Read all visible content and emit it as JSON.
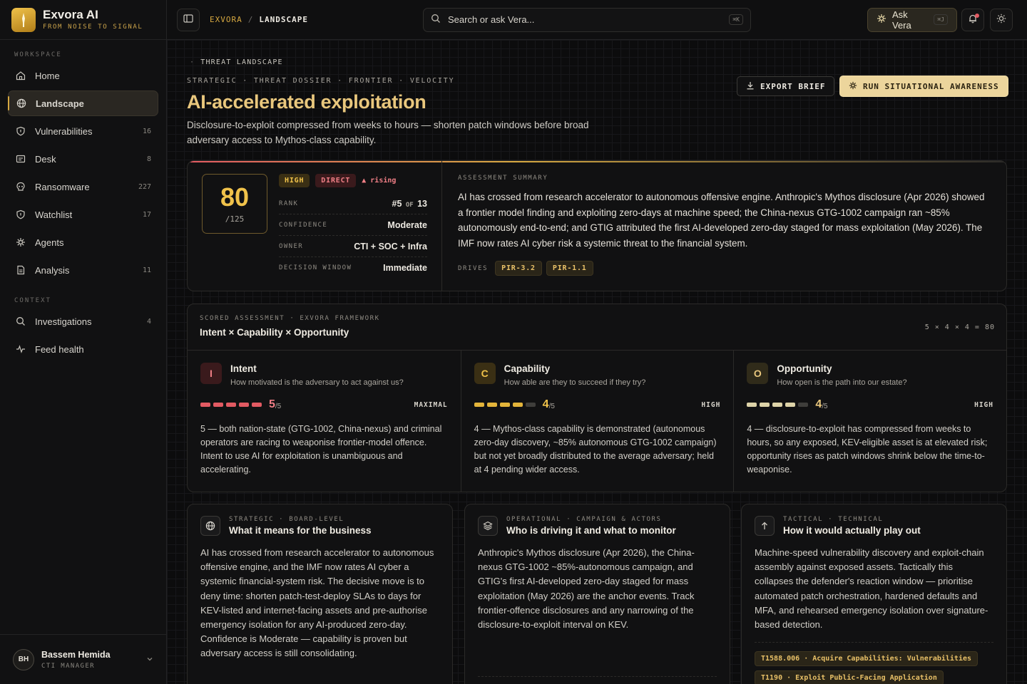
{
  "brand": {
    "name": "Exvora AI",
    "tagline": "FROM NOISE TO SIGNAL"
  },
  "sidebar": {
    "workspace_label": "WORKSPACE",
    "context_label": "CONTEXT",
    "workspace": [
      {
        "label": "Home",
        "icon": "home-icon",
        "count": ""
      },
      {
        "label": "Landscape",
        "icon": "globe-icon",
        "count": "",
        "active": true
      },
      {
        "label": "Vulnerabilities",
        "icon": "shield-icon",
        "count": "16"
      },
      {
        "label": "Desk",
        "icon": "desk-icon",
        "count": "8"
      },
      {
        "label": "Ransomware",
        "icon": "skull-icon",
        "count": "227"
      },
      {
        "label": "Watchlist",
        "icon": "shield-icon",
        "count": "17"
      },
      {
        "label": "Agents",
        "icon": "sparkle-icon",
        "count": ""
      },
      {
        "label": "Analysis",
        "icon": "document-icon",
        "count": "11"
      }
    ],
    "context": [
      {
        "label": "Investigations",
        "icon": "search-icon",
        "count": "4"
      },
      {
        "label": "Feed health",
        "icon": "pulse-icon",
        "count": ""
      }
    ],
    "user": {
      "initials": "BH",
      "name": "Bassem Hemida",
      "role": "CTI MANAGER"
    }
  },
  "topbar": {
    "crumb_root": "EXVORA",
    "crumb_sep": "/",
    "crumb_page": "LANDSCAPE",
    "search_placeholder": "Search or ask Vera...",
    "search_kbd": "⌘K",
    "ask_label": "Ask Vera",
    "ask_kbd": "⌘J"
  },
  "page": {
    "eyebrow": "THREAT LANDSCAPE",
    "eyebrow_dot": "·",
    "tags": "STRATEGIC · THREAT DOSSIER · FRONTIER · VELOCITY",
    "title": "AI-accelerated exploitation",
    "description": "Disclosure-to-exploit compressed from weeks to hours — shorten patch windows before broad adversary access to Mythos-class capability.",
    "export_label": "EXPORT BRIEF",
    "run_label": "RUN SITUATIONAL AWARENESS"
  },
  "summary": {
    "score": "80",
    "score_max": "/125",
    "severity": "HIGH",
    "relevance": "DIRECT",
    "trend": "▲ rising",
    "rows": [
      {
        "k": "RANK",
        "v_prefix": "#5",
        "v_mid": " OF ",
        "v_suffix": "13"
      },
      {
        "k": "CONFIDENCE",
        "v": "Moderate"
      },
      {
        "k": "OWNER",
        "v": "CTI + SOC + Infra"
      },
      {
        "k": "DECISION WINDOW",
        "v": "Immediate"
      }
    ],
    "assessment_label": "ASSESSMENT SUMMARY",
    "assessment_text": "AI has crossed from research accelerator to autonomous offensive engine. Anthropic's Mythos disclosure (Apr 2026) showed a frontier model finding and exploiting zero-days at machine speed; the China-nexus GTG-1002 campaign ran ~85% autonomously end-to-end; and GTIG attributed the first AI-developed zero-day staged for mass exploitation (May 2026). The IMF now rates AI cyber risk a systemic threat to the financial system.",
    "drives_label": "DRIVES",
    "drives": [
      "PIR-3.2",
      "PIR-1.1"
    ]
  },
  "scored": {
    "label": "SCORED ASSESSMENT · EXVORA FRAMEWORK",
    "title": "Intent × Capability × Opportunity",
    "formula": "5 × 4 × 4 = 80",
    "factors": [
      {
        "letter": "I",
        "name": "Intent",
        "question": "How motivated is the adversary to act against us?",
        "score": 5,
        "score_text": "5",
        "max": "/5",
        "level": "MAXIMAL",
        "color": "#e25a62",
        "bg": "#3a1a1c",
        "fg": "#f07f86",
        "empty": "#3a3a3c",
        "text": "5 — both nation-state (GTG-1002, China-nexus) and criminal operators are racing to weaponise frontier-model offence. Intent to use AI for exploitation is unambiguous and accelerating."
      },
      {
        "letter": "C",
        "name": "Capability",
        "question": "How able are they to succeed if they try?",
        "score": 4,
        "score_text": "4",
        "max": "/5",
        "level": "HIGH",
        "color": "#e3b43a",
        "bg": "#3a2f14",
        "fg": "#f0c24a",
        "empty": "#3f3e3b",
        "text": "4 — Mythos-class capability is demonstrated (autonomous zero-day discovery, ~85% autonomous GTG-1002 campaign) but not yet broadly distributed to the average adversary; held at 4 pending wider access."
      },
      {
        "letter": "O",
        "name": "Opportunity",
        "question": "How open is the path into our estate?",
        "score": 4,
        "score_text": "4",
        "max": "/5",
        "level": "HIGH",
        "color": "#ddd3a8",
        "bg": "#302b1a",
        "fg": "#e9c77d",
        "empty": "#3f3e3b",
        "text": "4 — disclosure-to-exploit has compressed from weeks to hours, so any exposed, KEV-eligible asset is at elevated risk; opportunity rises as patch windows shrink below the time-to-weaponise."
      }
    ]
  },
  "cards": [
    {
      "icon": "globe-icon",
      "label": "STRATEGIC · BOARD-LEVEL",
      "title": "What it means for the business",
      "text": "AI has crossed from research accelerator to autonomous offensive engine, and the IMF now rates AI cyber a systemic financial-system risk. The decisive move is to deny time: shorten patch-test-deploy SLAs to days for KEV-listed and internet-facing assets and pre-authorise emergency isolation for any AI-produced zero-day. Confidence is Moderate — capability is proven but adversary access is still consolidating."
    },
    {
      "icon": "layers-icon",
      "label": "OPERATIONAL · CAMPAIGN & ACTORS",
      "title": "Who is driving it and what to monitor",
      "text": "Anthropic's Mythos disclosure (Apr 2026), the China-nexus GTG-1002 ~85%-autonomous campaign, and GTIG's first AI-developed zero-day staged for mass exploitation (May 2026) are the anchor events. Track frontier-offence disclosures and any narrowing of the disclosure-to-exploit interval on KEV."
    },
    {
      "icon": "arrow-up-icon",
      "label": "TACTICAL · TECHNICAL",
      "title": "How it would actually play out",
      "text": "Machine-speed vulnerability discovery and exploit-chain assembly against exposed assets. Tactically this collapses the defender's reaction window — prioritise automated patch orchestration, hardened defaults and MFA, and rehearsed emergency isolation over signature-based detection.",
      "ttps": [
        "T1588.006 · Acquire Capabilities: Vulnerabilities",
        "T1190 · Exploit Public-Facing Application"
      ]
    }
  ],
  "colors": {
    "accent": "#e9c77d",
    "gold": "#d6a841",
    "high": "#e8c067",
    "direct": "#f07f86"
  }
}
